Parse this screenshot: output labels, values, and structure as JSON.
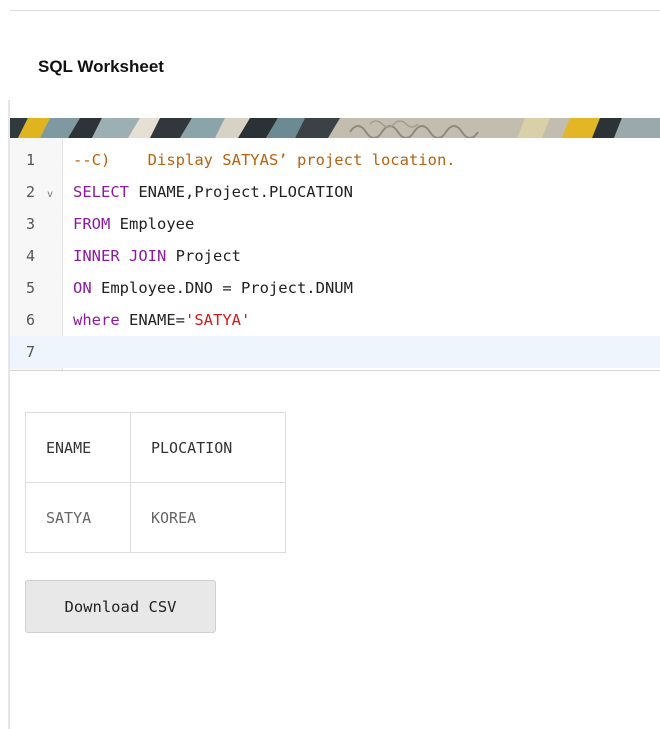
{
  "worksheet": {
    "title": "SQL Worksheet"
  },
  "editor": {
    "lines": [
      {
        "num": "1",
        "parts": [
          {
            "t": "--C)    Display SATYAS’ project location.",
            "c": "cm"
          }
        ]
      },
      {
        "num": "2",
        "fold": "v",
        "parts": [
          {
            "t": "SELECT",
            "c": "kw"
          },
          {
            "t": " ENAME,Project.PLOCATION",
            "c": ""
          }
        ]
      },
      {
        "num": "3",
        "parts": [
          {
            "t": "FROM",
            "c": "kw"
          },
          {
            "t": " Employee",
            "c": ""
          }
        ]
      },
      {
        "num": "4",
        "parts": [
          {
            "t": "INNER JOIN",
            "c": "kw"
          },
          {
            "t": " Project",
            "c": ""
          }
        ]
      },
      {
        "num": "5",
        "parts": [
          {
            "t": "ON",
            "c": "kw"
          },
          {
            "t": " Employee.DNO = Project.DNUM",
            "c": ""
          }
        ]
      },
      {
        "num": "6",
        "parts": [
          {
            "t": "where",
            "c": "kw"
          },
          {
            "t": " ENAME=",
            "c": ""
          },
          {
            "t": "'SATYA'",
            "c": "str"
          }
        ]
      },
      {
        "num": "7",
        "active": true,
        "parts": []
      }
    ]
  },
  "results": {
    "columns": [
      "ENAME",
      "PLOCATION"
    ],
    "rows": [
      [
        "SATYA",
        "KOREA"
      ]
    ]
  },
  "actions": {
    "download_csv_label": "Download CSV"
  }
}
